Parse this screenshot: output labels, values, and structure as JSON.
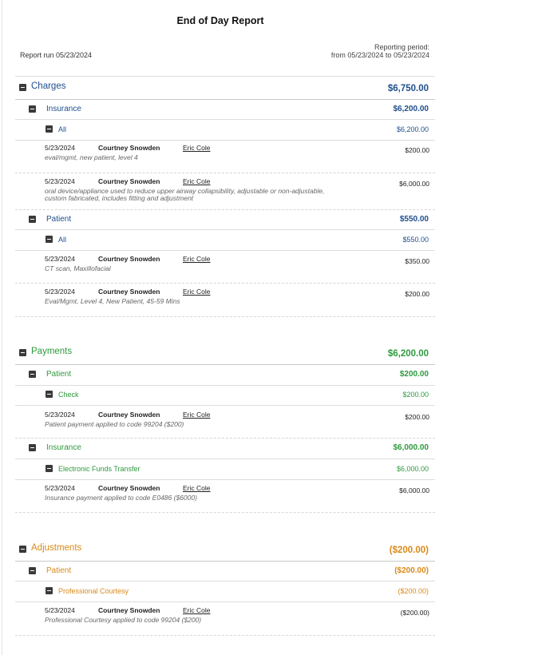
{
  "report": {
    "title": "End of Day Report",
    "run_label": "Report run 05/23/2024",
    "period_label": "Reporting period:",
    "period_range": "from 05/23/2024 to 05/23/2024"
  },
  "colors": {
    "charges": "#1f4e8c",
    "payments": "#2e9a3e",
    "adjustments": "#d9891a"
  },
  "charges": {
    "label": "Charges",
    "total": "$6,750.00",
    "insurance": {
      "label": "Insurance",
      "total": "$6,200.00",
      "all": {
        "label": "All",
        "total": "$6,200.00"
      },
      "entries": [
        {
          "date": "5/23/2024",
          "patient": "Courtney Snowden",
          "provider": "Eric Cole",
          "amount": "$200.00",
          "description": "eval/mgmt, new patient, level 4"
        },
        {
          "date": "5/23/2024",
          "patient": "Courtney Snowden",
          "provider": "Eric Cole",
          "amount": "$6,000.00",
          "description": "oral device/appliance used to reduce upper airway collapsibility, adjustable or non-adjustable, custom fabricated, includes fitting and adjustment"
        }
      ]
    },
    "patient": {
      "label": "Patient",
      "total": "$550.00",
      "all": {
        "label": "All",
        "total": "$550.00"
      },
      "entries": [
        {
          "date": "5/23/2024",
          "patient": "Courtney Snowden",
          "provider": "Eric Cole",
          "amount": "$350.00",
          "description": "CT scan, Maxillofacial"
        },
        {
          "date": "5/23/2024",
          "patient": "Courtney Snowden",
          "provider": "Eric Cole",
          "amount": "$200.00",
          "description": "Eval/Mgmt, Level 4, New Patient, 45-59 Mins"
        }
      ]
    }
  },
  "payments": {
    "label": "Payments",
    "total": "$6,200.00",
    "patient": {
      "label": "Patient",
      "total": "$200.00",
      "method": {
        "label": "Check",
        "total": "$200.00"
      },
      "entries": [
        {
          "date": "5/23/2024",
          "patient": "Courtney Snowden",
          "provider": "Eric Cole",
          "amount": "$200.00",
          "description": "Patient payment applied to code 99204 ($200)"
        }
      ]
    },
    "insurance": {
      "label": "Insurance",
      "total": "$6,000.00",
      "method": {
        "label": "Electronic Funds Transfer",
        "total": "$6,000.00"
      },
      "entries": [
        {
          "date": "5/23/2024",
          "patient": "Courtney Snowden",
          "provider": "Eric Cole",
          "amount": "$6,000.00",
          "description": "Insurance payment applied to code E0486 ($6000)"
        }
      ]
    }
  },
  "adjustments": {
    "label": "Adjustments",
    "total": "($200.00)",
    "patient": {
      "label": "Patient",
      "total": "($200.00)",
      "method": {
        "label": "Professional Courtesy",
        "total": "($200.00)"
      },
      "entries": [
        {
          "date": "5/23/2024",
          "patient": "Courtney Snowden",
          "provider": "Eric Cole",
          "amount": "($200.00)",
          "description": "Professional Courtesy applied to code 99204 ($200)"
        }
      ]
    }
  }
}
